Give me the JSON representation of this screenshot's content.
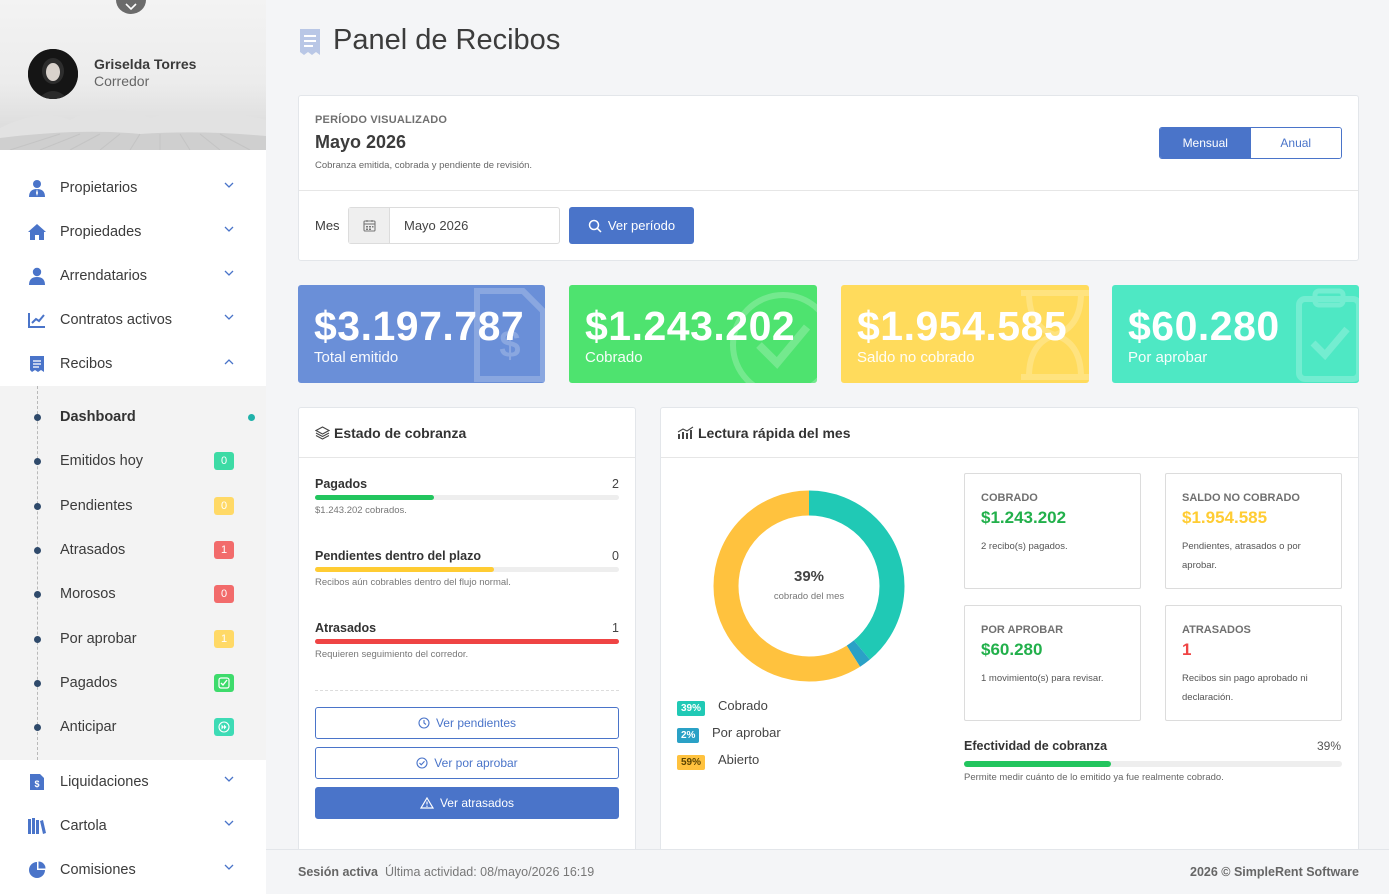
{
  "user": {
    "name": "Griselda Torres",
    "role": "Corredor"
  },
  "menu": [
    {
      "label": "Propietarios",
      "icon": "user-tie-icon",
      "chevron": "down"
    },
    {
      "label": "Propiedades",
      "icon": "home-icon",
      "chevron": "down"
    },
    {
      "label": "Arrendatarios",
      "icon": "user-icon",
      "chevron": "down"
    },
    {
      "label": "Contratos activos",
      "icon": "chart-contract-icon",
      "chevron": "down"
    },
    {
      "label": "Recibos",
      "icon": "receipt-icon",
      "chevron": "up"
    }
  ],
  "submenu": [
    {
      "label": "Dashboard",
      "active": true
    },
    {
      "label": "Emitidos hoy",
      "badge": "0",
      "badge_color": "#3ddba5"
    },
    {
      "label": "Pendientes",
      "badge": "0",
      "badge_color": "#ffd966"
    },
    {
      "label": "Atrasados",
      "badge": "1",
      "badge_color": "#f26b6b"
    },
    {
      "label": "Morosos",
      "badge": "0",
      "badge_color": "#f26b6b"
    },
    {
      "label": "Por aprobar",
      "badge": "1",
      "badge_color": "#ffd966"
    },
    {
      "label": "Pagados",
      "badge_icon": "check-square-icon",
      "badge_color": "#3ddb6b"
    },
    {
      "label": "Anticipar",
      "badge_icon": "fast-forward-icon",
      "badge_color": "#3ddbb5"
    }
  ],
  "menu2": [
    {
      "label": "Liquidaciones",
      "icon": "file-dollar-icon"
    },
    {
      "label": "Cartola",
      "icon": "books-icon"
    },
    {
      "label": "Comisiones",
      "icon": "pie-chart-icon"
    }
  ],
  "page": {
    "title": "Panel de Recibos",
    "title_icon": "receipt-icon"
  },
  "period": {
    "label": "PERÍODO VISUALIZADO",
    "value": "Mayo 2026",
    "description": "Cobranza emitida, cobrada y pendiente de revisión.",
    "toggle": [
      "Mensual",
      "Anual"
    ],
    "toggle_selected": "Mensual",
    "mes_label": "Mes",
    "mes_value": "Mayo 2026",
    "button": "Ver período"
  },
  "stats": [
    {
      "amount": "$3.197.787",
      "label": "Total emitido",
      "color": "#6a8fd8",
      "icon": "file-dollar-icon"
    },
    {
      "amount": "$1.243.202",
      "label": "Cobrado",
      "color": "#4ee36f",
      "icon": "check-circle-icon"
    },
    {
      "amount": "$1.954.585",
      "label": "Saldo no cobrado",
      "color": "#ffdb5c",
      "icon": "hourglass-icon"
    },
    {
      "amount": "$60.280",
      "label": "Por aprobar",
      "color": "#4ee8c4",
      "icon": "clipboard-check-icon"
    }
  ],
  "estado": {
    "title": "Estado de cobranza",
    "items": [
      {
        "label": "Pagados",
        "count": "2",
        "desc": "$1.243.202 cobrados.",
        "fraction": 0.39,
        "color": "#22c55e"
      },
      {
        "label": "Pendientes dentro del plazo",
        "count": "0",
        "desc": "Recibos aún cobrables dentro del flujo normal.",
        "fraction": 0.59,
        "color": "#ffcc33"
      },
      {
        "label": "Atrasados",
        "count": "1",
        "desc": "Requieren seguimiento del corredor.",
        "fraction": 1.0,
        "color": "#ef4444"
      }
    ],
    "buttons": [
      "Ver pendientes",
      "Ver por aprobar",
      "Ver atrasados"
    ]
  },
  "lectura": {
    "title": "Lectura rápida del mes",
    "donut": {
      "center_value": "39%",
      "center_label": "cobrado del mes",
      "segments": [
        {
          "label": "Cobrado",
          "percent": 39,
          "badge": "39%",
          "color": "#20c9b5"
        },
        {
          "label": "Por aprobar",
          "percent": 2,
          "badge": "2%",
          "color": "#2aa1c6"
        },
        {
          "label": "Abierto",
          "percent": 59,
          "badge": "59%",
          "color": "#ffc23e"
        }
      ]
    },
    "cards": [
      {
        "header": "COBRADO",
        "value": "$1.243.202",
        "value_color": "#22b04b",
        "desc": "2 recibo(s) pagados."
      },
      {
        "header": "SALDO NO COBRADO",
        "value": "$1.954.585",
        "value_color": "#ffcc33",
        "desc": "Pendientes, atrasados o por aprobar."
      },
      {
        "header": "POR APROBAR",
        "value": "$60.280",
        "value_color": "#22b04b",
        "desc": "1 movimiento(s) para revisar."
      },
      {
        "header": "ATRASADOS",
        "value": "1",
        "value_color": "#ef4444",
        "desc": "Recibos sin pago aprobado ni declaración."
      }
    ],
    "efectividad": {
      "label": "Efectividad de cobranza",
      "percent": "39%",
      "fraction": 0.39,
      "desc": "Permite medir cuánto de lo emitido ya fue realmente cobrado."
    }
  },
  "footer": {
    "session": "Sesión activa",
    "activity": "Última actividad: 08/mayo/2026 16:19",
    "copyright": "2026 © SimpleRent Software"
  }
}
